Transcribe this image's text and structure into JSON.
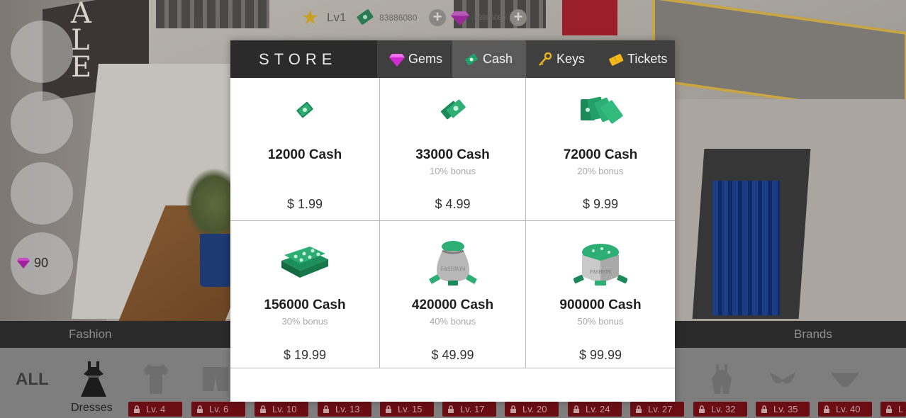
{
  "hud": {
    "level": "Lv1",
    "cash": "83886080",
    "gems": "83886080",
    "side_gems": "90"
  },
  "store": {
    "title": "STORE",
    "tabs": [
      {
        "label": "Gems",
        "icon": "gem-icon"
      },
      {
        "label": "Cash",
        "icon": "cash-icon"
      },
      {
        "label": "Keys",
        "icon": "key-icon"
      },
      {
        "label": "Tickets",
        "icon": "ticket-icon"
      }
    ],
    "active_tab": "Cash",
    "items": [
      {
        "title": "12000 Cash",
        "bonus": "",
        "price": "$ 1.99",
        "icon": "cash-single-icon"
      },
      {
        "title": "33000 Cash",
        "bonus": "10% bonus",
        "price": "$ 4.99",
        "icon": "cash-double-icon"
      },
      {
        "title": "72000 Cash",
        "bonus": "20% bonus",
        "price": "$ 9.99",
        "icon": "cash-fan-icon"
      },
      {
        "title": "156000 Cash",
        "bonus": "30% bonus",
        "price": "$ 19.99",
        "icon": "cash-stack-icon"
      },
      {
        "title": "420000 Cash",
        "bonus": "40% bonus",
        "price": "$ 49.99",
        "icon": "cash-bag-icon"
      },
      {
        "title": "900000 Cash",
        "bonus": "50% bonus",
        "price": "$ 99.99",
        "icon": "cash-box-icon"
      }
    ]
  },
  "categories": {
    "left": "Fashion",
    "right": "Brands"
  },
  "items_bar": {
    "all_label": "ALL",
    "selected_label": "Dresses",
    "locks": [
      "Lv. 4",
      "Lv. 6",
      "Lv. 10",
      "Lv. 13",
      "Lv. 15",
      "Lv. 17",
      "Lv. 20",
      "Lv. 24",
      "Lv. 27",
      "Lv. 32",
      "Lv. 35",
      "Lv. 40",
      "L"
    ]
  },
  "background": {
    "sign_text": "ALE"
  },
  "colors": {
    "cash_green": "#1e8a5a",
    "gem_magenta": "#d626d6",
    "lock_red": "#6b0e14"
  }
}
